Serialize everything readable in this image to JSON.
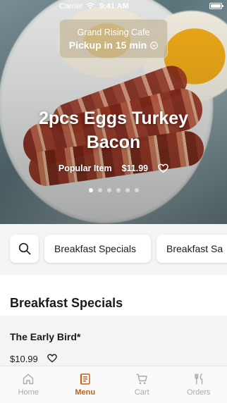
{
  "status_bar": {
    "carrier": "Carrier",
    "time": "9:41 AM"
  },
  "location": {
    "name": "Grand Rising Cafe",
    "pickup": "Pickup in 15 min"
  },
  "featured": {
    "title": "2pcs Eggs Turkey Bacon",
    "badge": "Popular Item",
    "price": "$11.99",
    "carousel_total": 6,
    "carousel_active": 0
  },
  "categories": {
    "search_icon": "search-icon",
    "items": [
      "Breakfast Specials",
      "Breakfast Sa"
    ]
  },
  "section": {
    "title": "Breakfast Specials",
    "items": [
      {
        "name": "The Early Bird*",
        "price": "$10.99"
      }
    ]
  },
  "tabs": [
    {
      "label": "Home",
      "icon": "home-icon"
    },
    {
      "label": "Menu",
      "icon": "menu-icon"
    },
    {
      "label": "Cart",
      "icon": "cart-icon"
    },
    {
      "label": "Orders",
      "icon": "orders-icon"
    }
  ],
  "colors": {
    "accent": "#c0621a",
    "tab_inactive": "#a9a9a9"
  }
}
